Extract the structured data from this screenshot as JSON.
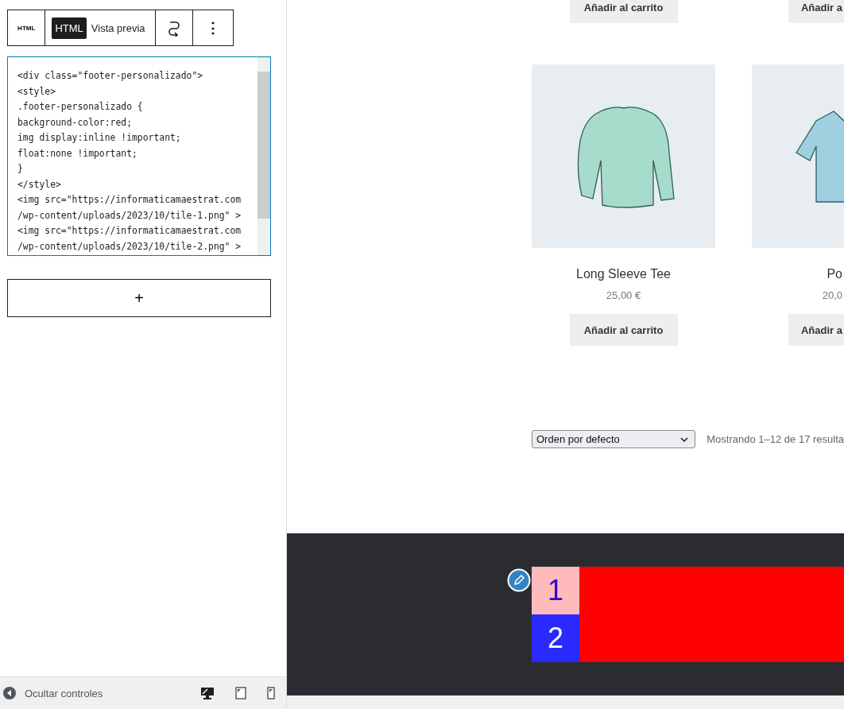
{
  "toolbar": {
    "block_label": "HTML",
    "tabs": [
      {
        "label": "HTML",
        "selected": true
      },
      {
        "label": "Vista previa",
        "selected": false
      }
    ],
    "more": "⋮"
  },
  "code_lines": [
    "<div class=\"footer-personalizado\">",
    "<style>",
    ".footer-personalizado {",
    "background-color:red;",
    "img display:inline !important;",
    "float:none !important;",
    "}",
    "</style>",
    "<img src=\"https://informaticamaestrat.com",
    "/wp-content/uploads/2023/10/tile-1.png\" >",
    "<img src=\"https://informaticamaestrat.com",
    "/wp-content/uploads/2023/10/tile-2.png\" >"
  ],
  "add_block": "+",
  "bottom_bar": {
    "label": "Ocultar controles",
    "devices": [
      {
        "kind": "desktop",
        "selected": true
      },
      {
        "kind": "tablet",
        "selected": false
      },
      {
        "kind": "mobile",
        "selected": false
      }
    ]
  },
  "top_buttons": [
    "Añadir al carrito",
    "Añadir a"
  ],
  "products": [
    {
      "kind": "longsleeve",
      "name": "Long Sleeve Tee",
      "price": "25,00 €",
      "button": "Añadir al carrito"
    },
    {
      "kind": "polo",
      "name": "Po",
      "price": "20,0",
      "button": "Añadir a"
    }
  ],
  "sort": {
    "value": "Orden por defecto"
  },
  "result_count": "Mostrando 1–12 de 17 resulta",
  "footer_tiles": [
    {
      "label": "1",
      "color": "#ffbbbb"
    },
    {
      "label": "2",
      "color": "#2a2aff"
    }
  ]
}
